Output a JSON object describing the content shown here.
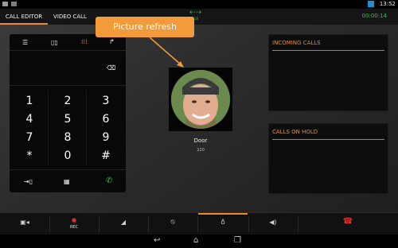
{
  "status_bar": {
    "time": "13:52"
  },
  "tabs": [
    {
      "label": "CALL EDITOR"
    },
    {
      "label": "VIDEO CALL"
    }
  ],
  "call_timer": "00:00:14",
  "call_indicator_label": "220",
  "tooltip": {
    "text": "Picture refresh"
  },
  "contact": {
    "name": "Door",
    "number": "220"
  },
  "keypad": {
    "keys": [
      "1",
      "2",
      "3",
      "4",
      "5",
      "6",
      "7",
      "8",
      "9",
      "*",
      "0",
      "#"
    ]
  },
  "panels": {
    "incoming": {
      "title": "INCOMING CALLS"
    },
    "on_hold": {
      "title": "CALLS ON HOLD"
    }
  },
  "bottom_bar": {
    "rec_label": "REC"
  },
  "colors": {
    "accent": "#f08a24",
    "call_green": "#29c34a",
    "rec_red": "#e0302a",
    "hangup_red": "#e3342f"
  },
  "icons": [
    "list-icon",
    "book-icon",
    "dialpad-icon",
    "call-transfer-icon",
    "backspace-icon",
    "transfer-arrow-icon",
    "keyboard-icon",
    "add-call-icon",
    "video-camera-icon",
    "record-icon",
    "volume-level-icon",
    "mute-mic-icon",
    "headset-icon",
    "speaker-icon",
    "hangup-icon",
    "back-icon",
    "home-icon",
    "recent-apps-icon"
  ]
}
